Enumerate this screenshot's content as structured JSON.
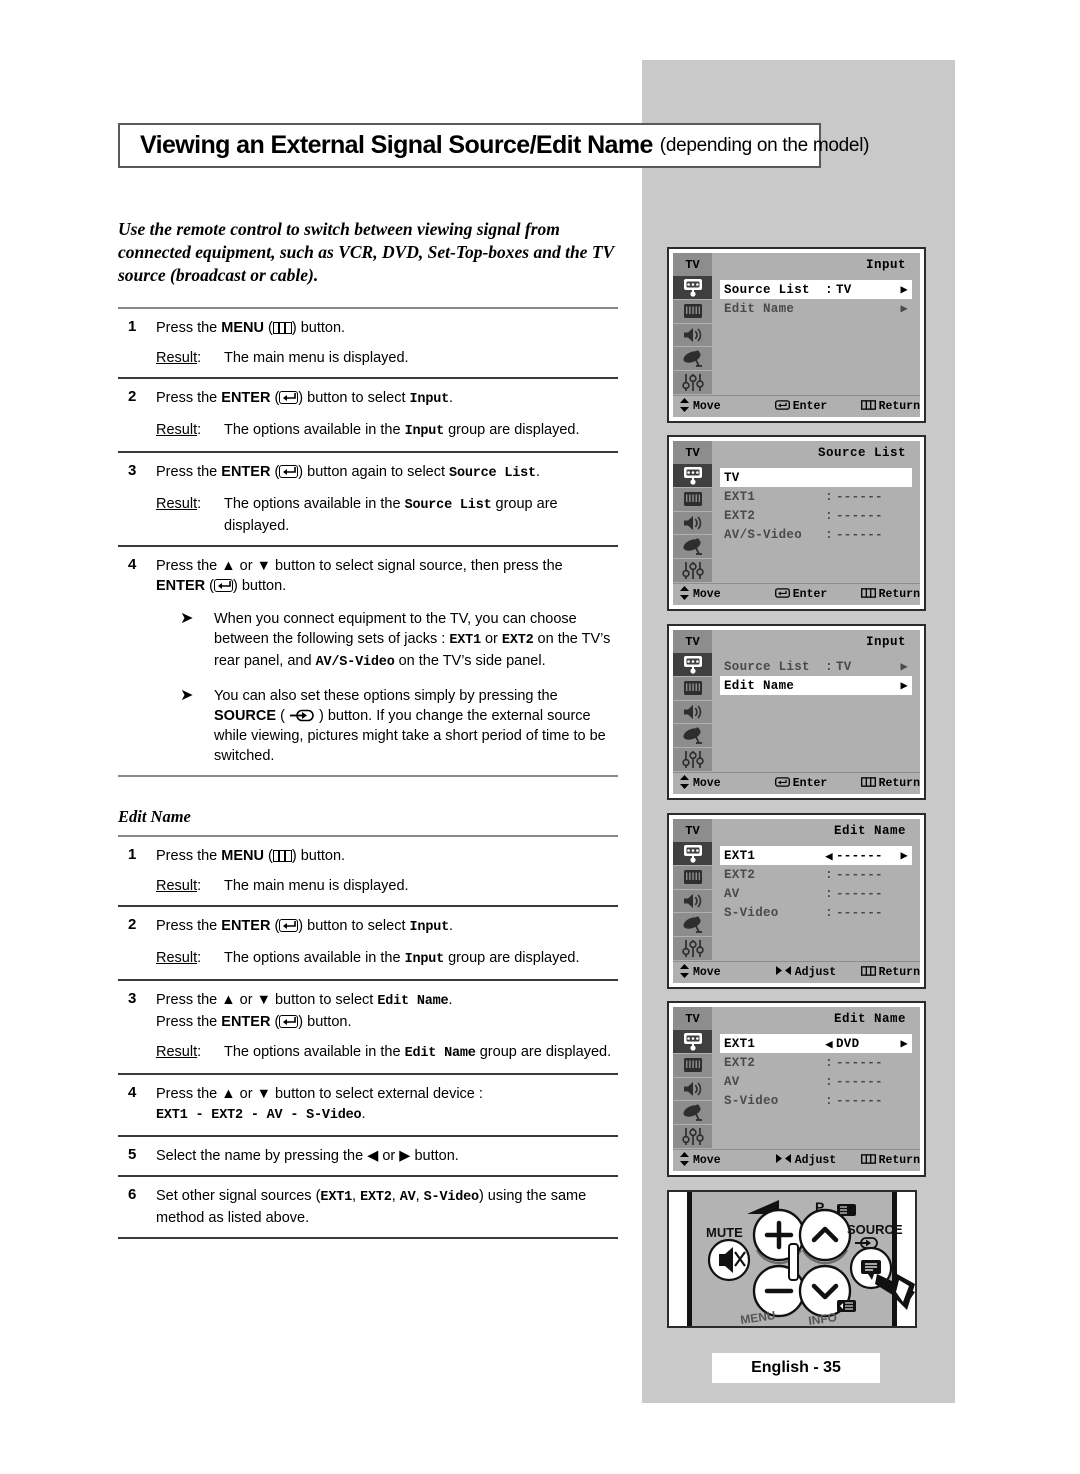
{
  "page": {
    "title_main": "Viewing an External Signal Source/Edit Name",
    "title_sub": "(depending on the model)",
    "footer": "English - 35"
  },
  "intro": "Use the remote control to switch between viewing signal from connected equipment, such as VCR, DVD, Set-Top-boxes and the TV source (broadcast or cable).",
  "labels": {
    "result": "Result",
    "colon": ":",
    "press_the": "Press the",
    "button_word": "button."
  },
  "section1": {
    "steps": [
      {
        "num": "1",
        "text_a": "Press the ",
        "bold": "MENU",
        "icon": "menu-icon",
        "text_b": ") button.",
        "result_label": "Result",
        "result_text": "The main menu is displayed."
      },
      {
        "num": "2",
        "text_a": "Press the ",
        "bold": "ENTER",
        "icon": "enter-icon",
        "text_b": ") button to select ",
        "mono": "Input",
        "text_c": ".",
        "result_label": "Result",
        "result_a": "The options available in the ",
        "result_mono": "Input",
        "result_b": " group are displayed."
      },
      {
        "num": "3",
        "text_a": "Press the ",
        "bold": "ENTER",
        "icon": "enter-icon",
        "text_b": ") button again to select ",
        "mono": "Source List",
        "text_c": ".",
        "result_label": "Result",
        "result_a": "The options available in the ",
        "result_mono": "Source List",
        "result_b": " group are displayed."
      },
      {
        "num": "4",
        "line1": "Press the ▲ or ▼ button to select signal source, then press the",
        "bold": "ENTER",
        "icon": "enter-icon",
        "text_b": ") button."
      }
    ],
    "notes": [
      {
        "bullet": "➤",
        "a": "When you connect equipment to the TV, you can choose between the following sets of jacks : ",
        "m1": "EXT1",
        "b": " or ",
        "m2": "EXT2",
        "c": " on the TV’s rear panel, and ",
        "m3": "AV/S-Video",
        "d": " on the TV’s side panel."
      },
      {
        "bullet": "➤",
        "a": "You can also set these options simply by pressing the ",
        "bold": "SOURCE",
        "icon": "source-icon",
        "b": " ) button. If you change the external source while viewing, pictures might take a short period of time to be switched."
      }
    ]
  },
  "section2": {
    "heading": "Edit Name",
    "steps": [
      {
        "num": "1",
        "text_a": "Press the ",
        "bold": "MENU",
        "icon": "menu-icon",
        "text_b": ") button.",
        "result_label": "Result",
        "result_text": "The main menu is displayed."
      },
      {
        "num": "2",
        "text_a": "Press the ",
        "bold": "ENTER",
        "icon": "enter-icon",
        "text_b": ") button to select ",
        "mono": "Input",
        "text_c": ".",
        "result_label": "Result",
        "result_a": "The options available in the ",
        "result_mono": "Input",
        "result_b": " group are displayed."
      },
      {
        "num": "3",
        "line1_a": "Press the ▲ or ▼ button to select ",
        "line1_mono": "Edit Name",
        "line1_b": ".",
        "line2_a": "Press the ",
        "line2_bold": "ENTER",
        "icon": "enter-icon",
        "line2_b": ") button.",
        "result_label": "Result",
        "result_a": "The options available in the ",
        "result_mono": "Edit Name",
        "result_b": " group are displayed."
      },
      {
        "num": "4",
        "line1": "Press the ▲ or ▼ button to select external device :",
        "line2_mono": "EXT1 - EXT2 - AV - S-Video",
        "line2_b": "."
      },
      {
        "num": "5",
        "line1": "Select the name by pressing the ◀ or ▶ button."
      },
      {
        "num": "6",
        "line1_a": "Set other signal sources (",
        "m1": "EXT1",
        "sa": ", ",
        "m2": "EXT2",
        "sb": ", ",
        "m3": "AV",
        "sc": ", ",
        "m4": "S-Video",
        "line1_b": ") using the same method as listed above."
      }
    ]
  },
  "osd": {
    "tv_tab": "TV",
    "rail_icons": [
      "input-source-icon",
      "picture-icon",
      "sound-icon",
      "satellite-dish-icon",
      "setup-sliders-icon"
    ],
    "footer_move": "Move",
    "footer_enter": "Enter",
    "footer_adjust": "Adjust",
    "footer_return": "Return",
    "panels": [
      {
        "title": "Input",
        "rows": [
          {
            "label": "Source List",
            "sep": ":",
            "value": "TV",
            "arrow": "▶",
            "selected": true
          },
          {
            "label": "Edit Name",
            "sep": "",
            "value": "",
            "arrow": "▶",
            "selected": false
          }
        ],
        "footer_mid": "Enter",
        "footer_mid_icon": "enter-icon"
      },
      {
        "title": "Source List",
        "rows": [
          {
            "label": "TV",
            "sep": "",
            "value": "",
            "arrow": "",
            "selected": true
          },
          {
            "label": "EXT1",
            "sep": ":",
            "value": "------",
            "arrow": "",
            "selected": false
          },
          {
            "label": "EXT2",
            "sep": ":",
            "value": "------",
            "arrow": "",
            "selected": false
          },
          {
            "label": "AV/S-Video",
            "sep": ":",
            "value": "------",
            "arrow": "",
            "selected": false
          }
        ],
        "footer_mid": "Enter",
        "footer_mid_icon": "enter-icon"
      },
      {
        "title": "Input",
        "rows": [
          {
            "label": "Source List",
            "sep": ":",
            "value": "TV",
            "arrow": "▶",
            "selected": false
          },
          {
            "label": "Edit Name",
            "sep": "",
            "value": "",
            "arrow": "▶",
            "selected": true
          }
        ],
        "footer_mid": "Enter",
        "footer_mid_icon": "enter-icon"
      },
      {
        "title": "Edit Name",
        "rows": [
          {
            "label": "EXT1",
            "sep": "◀",
            "value": "------",
            "arrow": "▶",
            "selected": true
          },
          {
            "label": "EXT2",
            "sep": ":",
            "value": "------",
            "arrow": "",
            "selected": false
          },
          {
            "label": "AV",
            "sep": ":",
            "value": "------",
            "arrow": "",
            "selected": false
          },
          {
            "label": "S-Video",
            "sep": ":",
            "value": "------",
            "arrow": "",
            "selected": false
          }
        ],
        "footer_mid": "Adjust",
        "footer_mid_icon": "left-right-arrows-icon"
      },
      {
        "title": "Edit Name",
        "rows": [
          {
            "label": "EXT1",
            "sep": "◀",
            "value": "DVD",
            "arrow": "▶",
            "selected": true
          },
          {
            "label": "EXT2",
            "sep": ":",
            "value": "------",
            "arrow": "",
            "selected": false
          },
          {
            "label": "AV",
            "sep": ":",
            "value": "------",
            "arrow": "",
            "selected": false
          },
          {
            "label": "S-Video",
            "sep": ":",
            "value": "------",
            "arrow": "",
            "selected": false
          }
        ],
        "footer_mid": "Adjust",
        "footer_mid_icon": "left-right-arrows-icon"
      }
    ]
  },
  "remote": {
    "mute_label": "MUTE",
    "p_label": "P",
    "source_label": "SOURCE",
    "plus_label": "+",
    "minus_label": "−"
  },
  "colors": {
    "panel_grey": "#c9c9c9",
    "osd_bg": "#b0b0b0",
    "osd_rail": "#8d8d8d",
    "osd_active": "#3f3f3f",
    "rule": "#8a8a8a"
  }
}
